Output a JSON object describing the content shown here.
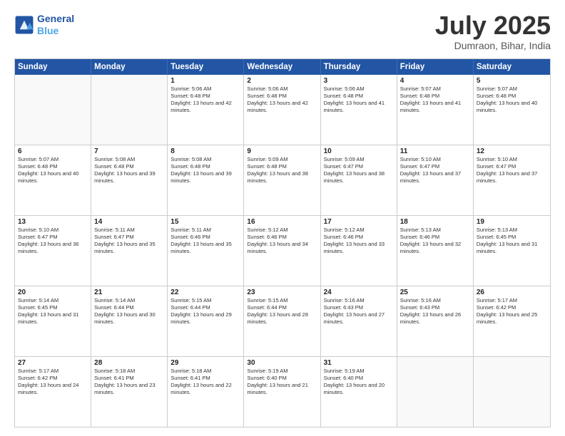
{
  "logo": {
    "line1": "General",
    "line2": "Blue"
  },
  "title": "July 2025",
  "location": "Dumraon, Bihar, India",
  "days_of_week": [
    "Sunday",
    "Monday",
    "Tuesday",
    "Wednesday",
    "Thursday",
    "Friday",
    "Saturday"
  ],
  "weeks": [
    [
      {
        "day": "",
        "empty": true
      },
      {
        "day": "",
        "empty": true
      },
      {
        "day": "1",
        "sunrise": "5:06 AM",
        "sunset": "6:48 PM",
        "daylight": "13 hours and 42 minutes."
      },
      {
        "day": "2",
        "sunrise": "5:06 AM",
        "sunset": "6:48 PM",
        "daylight": "13 hours and 42 minutes."
      },
      {
        "day": "3",
        "sunrise": "5:06 AM",
        "sunset": "6:48 PM",
        "daylight": "13 hours and 41 minutes."
      },
      {
        "day": "4",
        "sunrise": "5:07 AM",
        "sunset": "6:48 PM",
        "daylight": "13 hours and 41 minutes."
      },
      {
        "day": "5",
        "sunrise": "5:07 AM",
        "sunset": "6:48 PM",
        "daylight": "13 hours and 40 minutes."
      }
    ],
    [
      {
        "day": "6",
        "sunrise": "5:07 AM",
        "sunset": "6:48 PM",
        "daylight": "13 hours and 40 minutes."
      },
      {
        "day": "7",
        "sunrise": "5:08 AM",
        "sunset": "6:48 PM",
        "daylight": "13 hours and 39 minutes."
      },
      {
        "day": "8",
        "sunrise": "5:08 AM",
        "sunset": "6:48 PM",
        "daylight": "13 hours and 39 minutes."
      },
      {
        "day": "9",
        "sunrise": "5:09 AM",
        "sunset": "6:48 PM",
        "daylight": "13 hours and 38 minutes."
      },
      {
        "day": "10",
        "sunrise": "5:09 AM",
        "sunset": "6:47 PM",
        "daylight": "13 hours and 38 minutes."
      },
      {
        "day": "11",
        "sunrise": "5:10 AM",
        "sunset": "6:47 PM",
        "daylight": "13 hours and 37 minutes."
      },
      {
        "day": "12",
        "sunrise": "5:10 AM",
        "sunset": "6:47 PM",
        "daylight": "13 hours and 37 minutes."
      }
    ],
    [
      {
        "day": "13",
        "sunrise": "5:10 AM",
        "sunset": "6:47 PM",
        "daylight": "13 hours and 36 minutes."
      },
      {
        "day": "14",
        "sunrise": "5:11 AM",
        "sunset": "6:47 PM",
        "daylight": "13 hours and 35 minutes."
      },
      {
        "day": "15",
        "sunrise": "5:11 AM",
        "sunset": "6:46 PM",
        "daylight": "13 hours and 35 minutes."
      },
      {
        "day": "16",
        "sunrise": "5:12 AM",
        "sunset": "6:46 PM",
        "daylight": "13 hours and 34 minutes."
      },
      {
        "day": "17",
        "sunrise": "5:12 AM",
        "sunset": "6:46 PM",
        "daylight": "13 hours and 33 minutes."
      },
      {
        "day": "18",
        "sunrise": "5:13 AM",
        "sunset": "6:46 PM",
        "daylight": "13 hours and 32 minutes."
      },
      {
        "day": "19",
        "sunrise": "5:13 AM",
        "sunset": "6:45 PM",
        "daylight": "13 hours and 31 minutes."
      }
    ],
    [
      {
        "day": "20",
        "sunrise": "5:14 AM",
        "sunset": "6:45 PM",
        "daylight": "13 hours and 31 minutes."
      },
      {
        "day": "21",
        "sunrise": "5:14 AM",
        "sunset": "6:44 PM",
        "daylight": "13 hours and 30 minutes."
      },
      {
        "day": "22",
        "sunrise": "5:15 AM",
        "sunset": "6:44 PM",
        "daylight": "13 hours and 29 minutes."
      },
      {
        "day": "23",
        "sunrise": "5:15 AM",
        "sunset": "6:44 PM",
        "daylight": "13 hours and 28 minutes."
      },
      {
        "day": "24",
        "sunrise": "5:16 AM",
        "sunset": "6:43 PM",
        "daylight": "13 hours and 27 minutes."
      },
      {
        "day": "25",
        "sunrise": "5:16 AM",
        "sunset": "6:43 PM",
        "daylight": "13 hours and 26 minutes."
      },
      {
        "day": "26",
        "sunrise": "5:17 AM",
        "sunset": "6:42 PM",
        "daylight": "13 hours and 25 minutes."
      }
    ],
    [
      {
        "day": "27",
        "sunrise": "5:17 AM",
        "sunset": "6:42 PM",
        "daylight": "13 hours and 24 minutes."
      },
      {
        "day": "28",
        "sunrise": "5:18 AM",
        "sunset": "6:41 PM",
        "daylight": "13 hours and 23 minutes."
      },
      {
        "day": "29",
        "sunrise": "5:18 AM",
        "sunset": "6:41 PM",
        "daylight": "13 hours and 22 minutes."
      },
      {
        "day": "30",
        "sunrise": "5:19 AM",
        "sunset": "6:40 PM",
        "daylight": "13 hours and 21 minutes."
      },
      {
        "day": "31",
        "sunrise": "5:19 AM",
        "sunset": "6:40 PM",
        "daylight": "13 hours and 20 minutes."
      },
      {
        "day": "",
        "empty": true
      },
      {
        "day": "",
        "empty": true
      }
    ]
  ]
}
